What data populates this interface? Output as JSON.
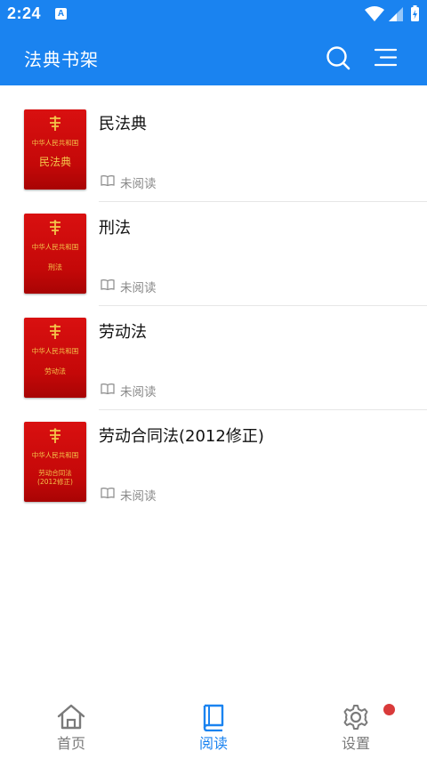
{
  "status_bar": {
    "time": "2:24",
    "notification_letter": "A"
  },
  "app_bar": {
    "title": "法典书架"
  },
  "books": [
    {
      "title": "民法典",
      "cover_country": "中华人民共和国",
      "cover_title": "民法典",
      "status": "未阅读"
    },
    {
      "title": "刑法",
      "cover_country": "中华人民共和国",
      "cover_title": "刑法",
      "status": "未阅读"
    },
    {
      "title": "劳动法",
      "cover_country": "中华人民共和国",
      "cover_title": "劳动法",
      "status": "未阅读"
    },
    {
      "title": "劳动合同法(2012修正)",
      "cover_country": "中华人民共和国",
      "cover_title": "劳动合同法\n(2012修正)",
      "status": "未阅读"
    }
  ],
  "bottom_nav": {
    "items": [
      {
        "label": "首页",
        "icon": "home-icon",
        "active": false
      },
      {
        "label": "阅读",
        "icon": "book-icon",
        "active": true
      },
      {
        "label": "设置",
        "icon": "gear-icon",
        "active": false
      }
    ]
  },
  "colors": {
    "primary": "#1a83f0",
    "cover_red": "#d91010",
    "cover_gold": "#f3c44a",
    "badge": "#d93a3a",
    "inactive": "#7a7a7a"
  }
}
